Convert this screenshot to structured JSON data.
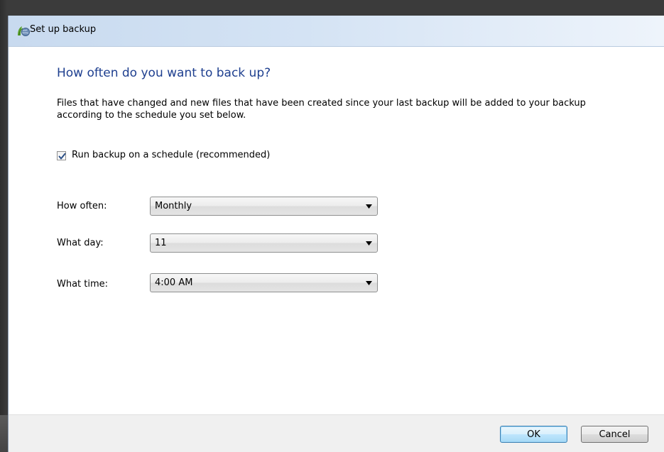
{
  "window": {
    "title": "Set up backup"
  },
  "content": {
    "heading": "How often do you want to back up?",
    "description": "Files that have changed and new files that have been created since your last backup will be added to your backup according to the schedule you set below.",
    "schedule_checkbox": {
      "label": "Run backup on a schedule (recommended)",
      "checked": true
    },
    "fields": {
      "how_often": {
        "label": "How often:",
        "value": "Monthly"
      },
      "what_day": {
        "label": "What day:",
        "value": "11"
      },
      "what_time": {
        "label": "What time:",
        "value": "4:00 AM"
      }
    }
  },
  "footer": {
    "ok_label": "OK",
    "cancel_label": "Cancel"
  },
  "colors": {
    "heading": "#1e3f8f",
    "titlebar": "#d4e3f4",
    "footer": "#f0f0f0"
  },
  "icons": {
    "title_icon": "backup-icon",
    "dropdown": "chevron-down-icon",
    "check": "checkmark-icon"
  }
}
